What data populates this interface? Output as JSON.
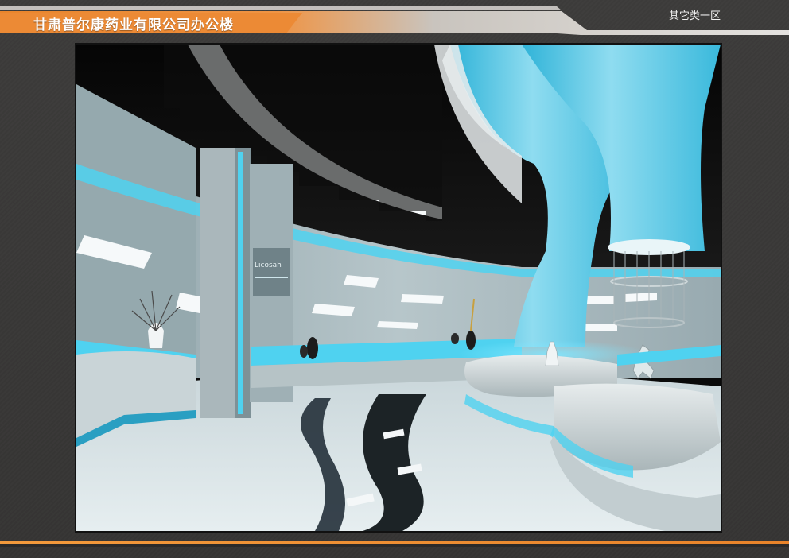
{
  "header": {
    "title": "甘肃普尔康药业有限公司办公楼",
    "section": "其它类一区"
  },
  "render": {
    "icon": "interior-rendering-image",
    "wall_sign": "Licosah"
  },
  "colors": {
    "accent_orange": "#ef8a32",
    "accent_cyan": "#4ec8e6",
    "background": "#3a3938"
  }
}
